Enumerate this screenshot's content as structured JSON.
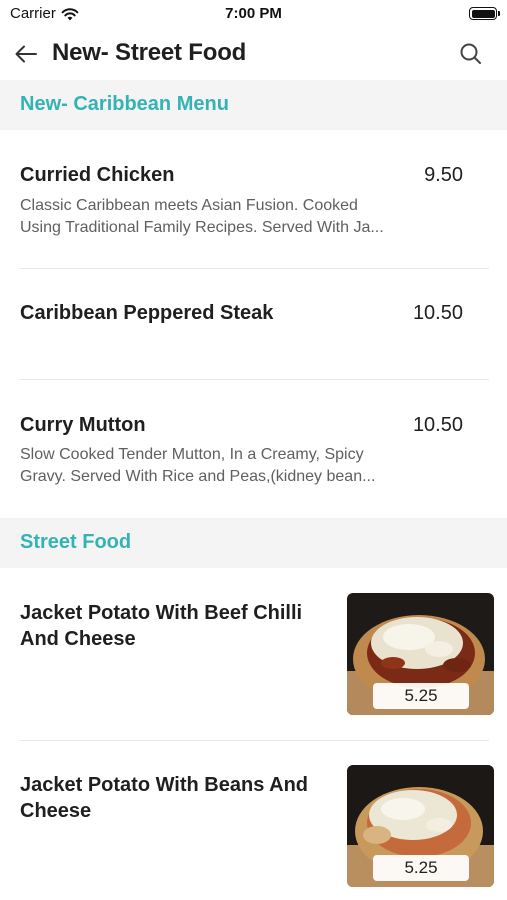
{
  "status_bar": {
    "carrier": "Carrier",
    "time": "7:00 PM"
  },
  "nav": {
    "title": "New- Street Food"
  },
  "sections": [
    {
      "title": "New- Caribbean Menu",
      "items": [
        {
          "name": "Curried Chicken",
          "price": "9.50",
          "desc_line1": "Classic Caribbean meets Asian Fusion. Cooked",
          "desc_line2": "Using Traditional Family Recipes. Served With Ja..."
        },
        {
          "name": "Caribbean Peppered Steak",
          "price": "10.50",
          "desc_line1": "",
          "desc_line2": ""
        },
        {
          "name": "Curry Mutton",
          "price": "10.50",
          "desc_line1": "Slow Cooked Tender Mutton, In a Creamy, Spicy",
          "desc_line2": "Gravy. Served With Rice and Peas,(kidney bean..."
        }
      ]
    },
    {
      "title": "Street Food",
      "items": [
        {
          "name_line1": "Jacket Potato With Beef Chilli",
          "name_line2": "And Cheese",
          "price": "5.25",
          "image": "jacket-potato-beef-chilli-photo"
        },
        {
          "name_line1": "Jacket Potato With Beans And",
          "name_line2": "Cheese",
          "price": "5.25",
          "image": "jacket-potato-beans-photo"
        }
      ]
    }
  ],
  "colors": {
    "accent": "#34b3b5",
    "section_bg": "#f4f4f4",
    "text": "#1f1f1f",
    "muted": "#5f5f5f"
  },
  "icons": [
    "wifi-icon",
    "battery-icon",
    "back-arrow-icon",
    "search-icon"
  ]
}
